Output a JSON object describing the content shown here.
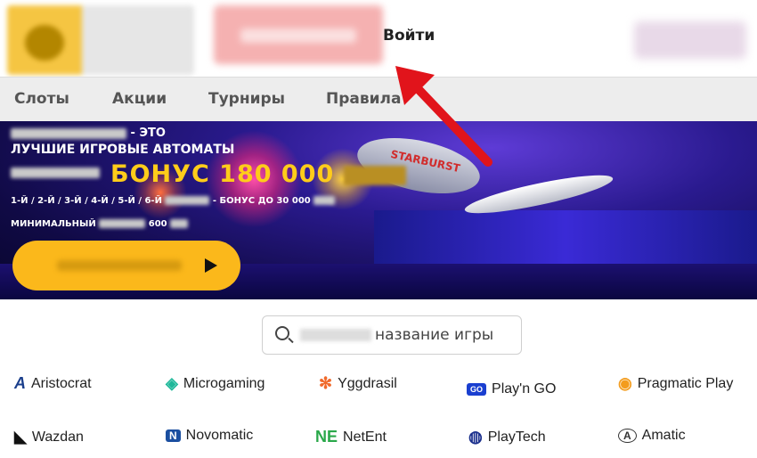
{
  "header": {
    "login_label": "Войти"
  },
  "nav": {
    "items": [
      "Слоты",
      "Акции",
      "Турниры",
      "Правила"
    ]
  },
  "banner": {
    "line1_suffix": "- ЭТО",
    "line2": "ЛУЧШИЕ ИГРОВЫЕ АВТОМАТЫ",
    "bonus": "БОНУС 180 000",
    "deposits": "1-Й / 2-Й / 3-Й / 4-Й / 5-Й / 6-Й",
    "deposits_bonus": "- БОНУС ДО 30 000",
    "min_label": "МИНИМАЛЬНЫЙ",
    "min_value": "600",
    "zeppelin_text": "STARBURST",
    "colors": {
      "bonus": "#ffcc1a",
      "button": "#fbb81b"
    }
  },
  "search": {
    "placeholder_visible": "название игры"
  },
  "providers": [
    {
      "name": "Aristocrat",
      "icon": "aristocrat-icon",
      "color": "#1b3f8c"
    },
    {
      "name": "Microgaming",
      "icon": "microgaming-icon",
      "color": "#1fb89a"
    },
    {
      "name": "Yggdrasil",
      "icon": "yggdrasil-icon",
      "color": "#f06a2c"
    },
    {
      "name": "Play'n GO",
      "icon": "playngo-icon",
      "color": "#1a3fd0"
    },
    {
      "name": "Pragmatic Play",
      "icon": "pragmatic-icon",
      "color": "#f39c1d"
    },
    {
      "name": "Wazdan",
      "icon": "wazdan-icon",
      "color": "#111111"
    },
    {
      "name": "Novomatic",
      "icon": "novomatic-icon",
      "color": "#1b4fa0"
    },
    {
      "name": "NetEnt",
      "icon": "netent-icon",
      "color": "#2aa84a"
    },
    {
      "name": "PlayTech",
      "icon": "playtech-icon",
      "color": "#1a2f8c"
    },
    {
      "name": "Amatic",
      "icon": "amatic-icon",
      "color": "#333333"
    }
  ]
}
